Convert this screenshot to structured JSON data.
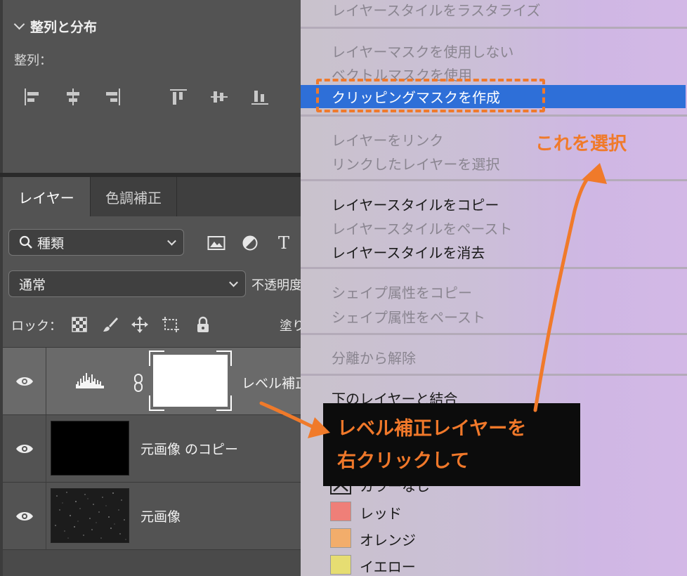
{
  "align_panel": {
    "title": "整列と分布",
    "align_label": "整列："
  },
  "tabs": [
    {
      "label": "レイヤー"
    },
    {
      "label": "色調補正"
    }
  ],
  "filter": {
    "kind_value": "種類",
    "filter_icons": [
      "image-icon",
      "adjustment-icon",
      "type-icon"
    ]
  },
  "blend": {
    "mode_value": "通常",
    "opacity_label": "不透明度"
  },
  "lock": {
    "label": "ロック：",
    "fill_label": "塗り"
  },
  "layers": [
    {
      "name": "レベル補正",
      "type": "adjustment"
    },
    {
      "name": "元画像 のコピー",
      "type": "image"
    },
    {
      "name": "元画像",
      "type": "image"
    }
  ],
  "context_menu": {
    "items": [
      {
        "label": "レイヤースタイルをラスタライズ",
        "enabled": false
      },
      {
        "label": "レイヤーマスクを使用しない",
        "enabled": false
      },
      {
        "label": "ベクトルマスクを使用",
        "enabled": false
      },
      {
        "label": "クリッピングマスクを作成",
        "enabled": true,
        "highlighted": true
      },
      {
        "label": "レイヤーをリンク",
        "enabled": false
      },
      {
        "label": "リンクしたレイヤーを選択",
        "enabled": false
      },
      {
        "label": "レイヤースタイルをコピー",
        "enabled": true
      },
      {
        "label": "レイヤースタイルをペースト",
        "enabled": false
      },
      {
        "label": "レイヤースタイルを消去",
        "enabled": true
      },
      {
        "label": "シェイプ属性をコピー",
        "enabled": false
      },
      {
        "label": "シェイプ属性をペースト",
        "enabled": false
      },
      {
        "label": "分離から解除",
        "enabled": false
      },
      {
        "label": "下のレイヤーと結合",
        "enabled": true
      }
    ],
    "colors": [
      {
        "label": "カラーなし",
        "color": "none"
      },
      {
        "label": "レッド",
        "color": "#ef7f78"
      },
      {
        "label": "オレンジ",
        "color": "#f2ad6b"
      },
      {
        "label": "イエロー",
        "color": "#e6dd72"
      }
    ]
  },
  "annotations": {
    "select_note": "これを選択",
    "callout_line1": "レベル補正レイヤーを",
    "callout_line2": "右クリックして",
    "accent_color": "#f07a2a"
  }
}
